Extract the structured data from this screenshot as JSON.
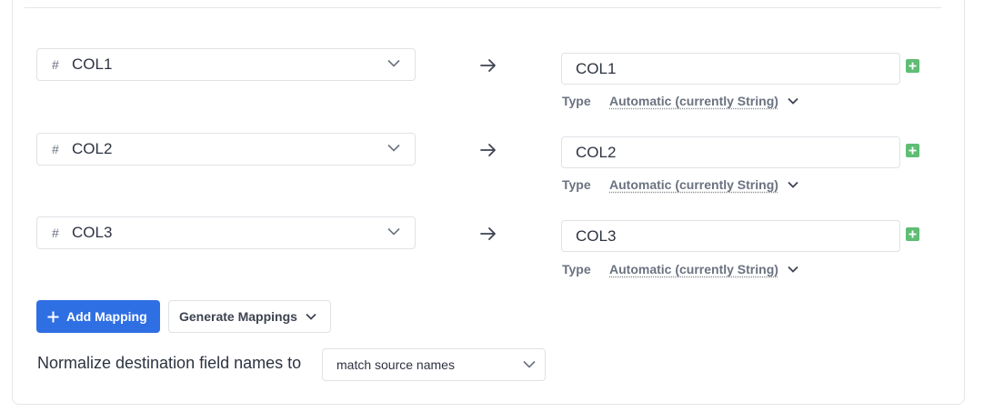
{
  "mappings": [
    {
      "source_prefix": "#",
      "source": "COL1",
      "dest": "COL1",
      "type_label": "Type",
      "type_value": "Automatic (currently String)"
    },
    {
      "source_prefix": "#",
      "source": "COL2",
      "dest": "COL2",
      "type_label": "Type",
      "type_value": "Automatic (currently String)"
    },
    {
      "source_prefix": "#",
      "source": "COL3",
      "dest": "COL3",
      "type_label": "Type",
      "type_value": "Automatic (currently String)"
    }
  ],
  "actions": {
    "add_mapping_label": "Add Mapping",
    "add_mapping_icon": "plus-icon",
    "generate_mappings_label": "Generate Mappings"
  },
  "normalize": {
    "label": "Normalize destination field names to",
    "selected": "match source names"
  },
  "colors": {
    "primary": "#2f6fe4",
    "add_field": "#5fbd74",
    "border": "#dfe2e6"
  }
}
